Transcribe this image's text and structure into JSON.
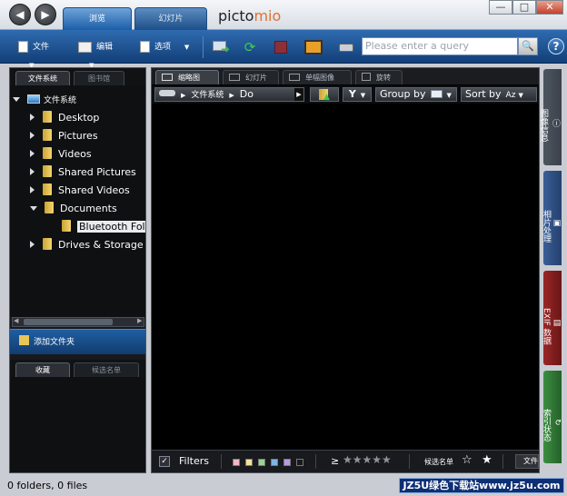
{
  "titlebar": {
    "tabs": [
      "浏览",
      "幻灯片"
    ],
    "logo_left": "picto",
    "logo_right": "mio",
    "window_buttons": [
      "—",
      "□",
      "✕"
    ]
  },
  "toolbar": {
    "file_label": "文件",
    "edit_label": "编辑",
    "options_label": "选项",
    "search_placeholder": "Please enter a query",
    "help_label": "?"
  },
  "left_panel": {
    "tabs": [
      "文件系统",
      "图书馆"
    ],
    "tree": {
      "root": "文件系统",
      "items": [
        "Desktop",
        "Pictures",
        "Videos",
        "Shared Pictures",
        "Shared Videos",
        "Documents",
        "Bluetooth Folder",
        "Drives & Storage Devices"
      ]
    },
    "add_folder_label": "添加文件夹",
    "bottom_tabs": [
      "收藏",
      "候选名单"
    ]
  },
  "main_panel": {
    "tabs": [
      "缩略图",
      "幻灯片",
      "单幅图像",
      "旋转"
    ],
    "path": [
      "文件系统",
      "Do"
    ],
    "group_by_label": "Group by",
    "sort_by_label": "Sort by",
    "sort_indicator": "Az",
    "filters_label": "Filters",
    "rating_prefix": "≥",
    "shortlist_label": "候选名单",
    "file_label": "文件",
    "swatch_colors": [
      "#f2b8c6",
      "#f3e29a",
      "#9ad48e",
      "#7fb3e6",
      "#b69ae0",
      "#ffffff"
    ]
  },
  "right_sidebar": {
    "tabs": [
      "图像信息",
      "相片处理",
      "EXIF 数据",
      "索引状态"
    ],
    "colors": [
      "#4d5560",
      "#2c4f86",
      "#8a1f1f",
      "#2e7d32"
    ]
  },
  "status": {
    "text": "0 folders, 0 files",
    "watermark": "JZ5U绿色下载站www.jz5u.com"
  }
}
